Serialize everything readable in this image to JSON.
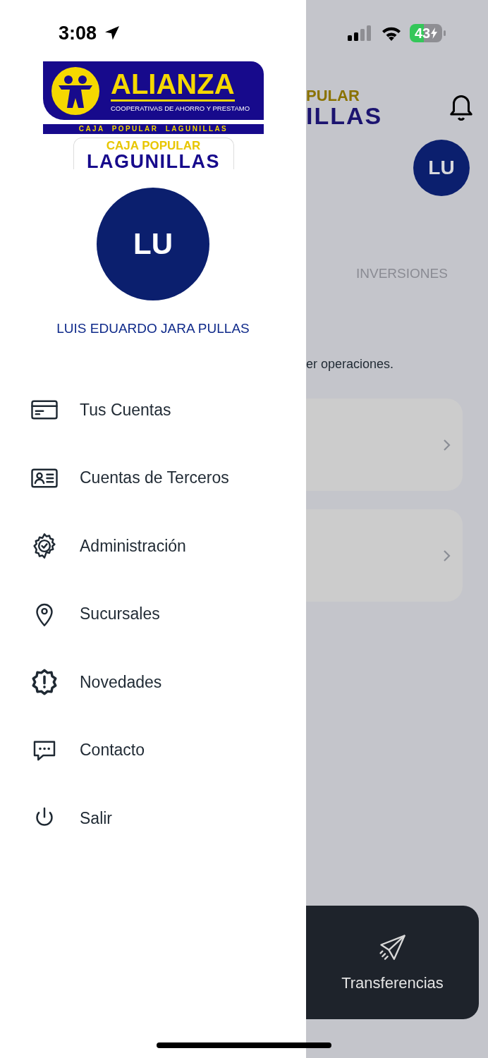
{
  "status_bar": {
    "time": "3:08",
    "battery": "43"
  },
  "drawer": {
    "logo": {
      "brand": "ALIANZA",
      "tagline": "COOPERATIVAS DE AHORRO Y PRESTAMO",
      "band": "CAJA  POPULAR  LAGUNILLAS",
      "sub_top": "CAJA POPULAR",
      "sub_bottom": "LAGUNILLAS"
    },
    "avatar": "LU",
    "user_name": "LUIS EDUARDO JARA PULLAS",
    "menu": [
      {
        "label": "Tus Cuentas"
      },
      {
        "label": "Cuentas de Terceros"
      },
      {
        "label": "Administración"
      },
      {
        "label": "Sucursales"
      },
      {
        "label": "Novedades"
      },
      {
        "label": "Contacto"
      },
      {
        "label": "Salir"
      }
    ]
  },
  "background": {
    "header_logo": {
      "top": "PULAR",
      "bottom": "ILLAS"
    },
    "avatar": "LU",
    "tab": "INVERSIONES",
    "hint": "er operaciones.",
    "cards": [
      {
        "kind": "link"
      },
      {
        "kind": "link"
      }
    ],
    "transfer": {
      "label": "Transferencias"
    }
  }
}
